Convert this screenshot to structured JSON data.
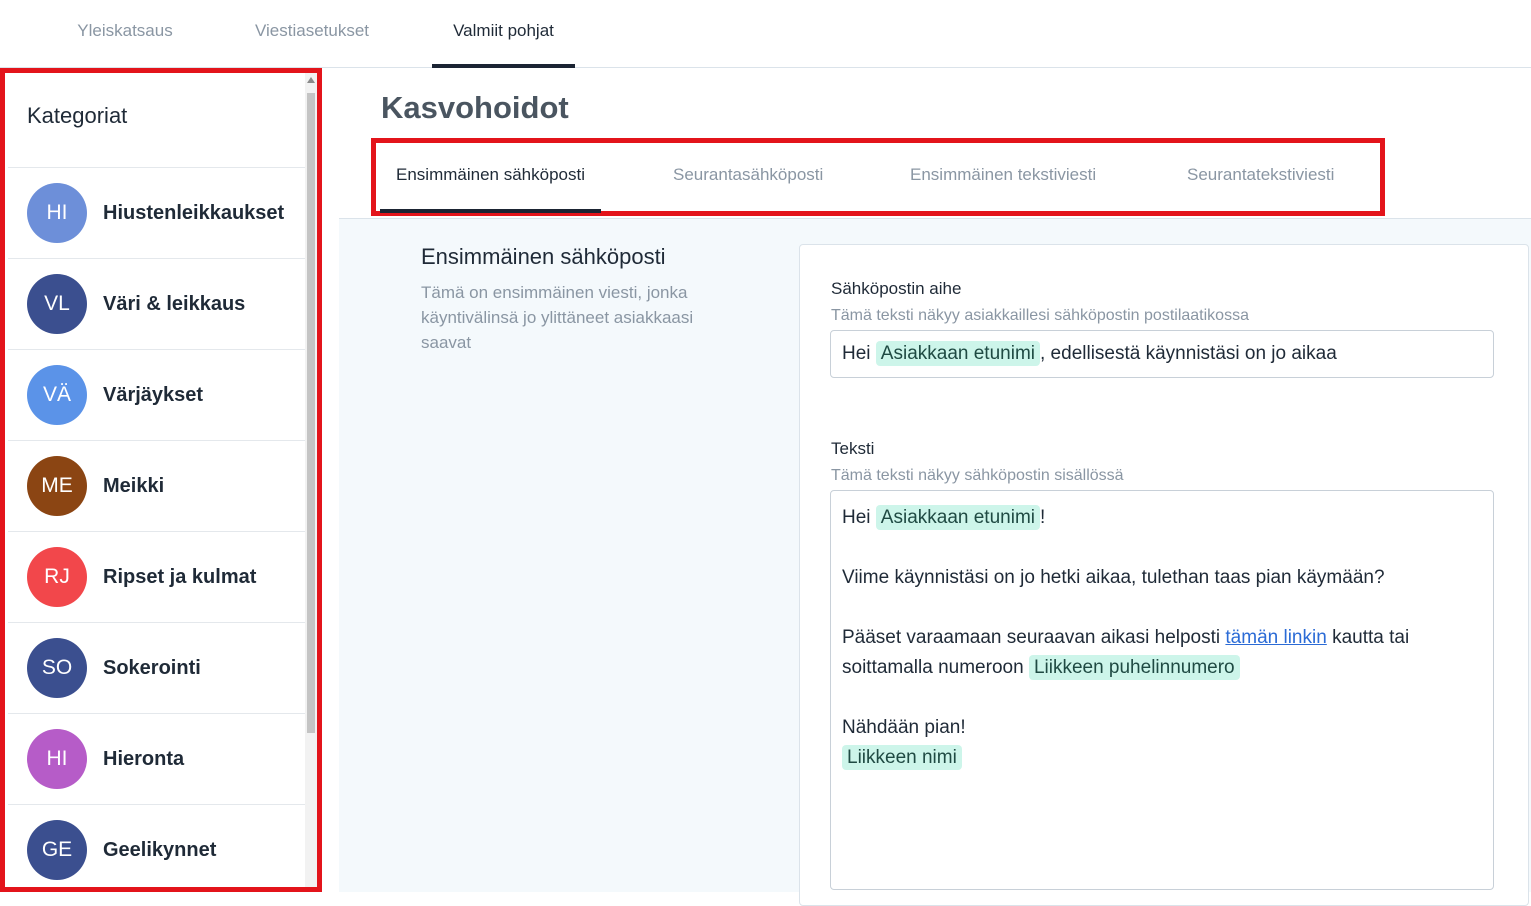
{
  "top_tabs": [
    {
      "label": "Yleiskatsaus"
    },
    {
      "label": "Viestiasetukset"
    },
    {
      "label": "Valmiit pohjat"
    }
  ],
  "sidebar": {
    "title": "Kategoriat",
    "items": [
      {
        "initials": "HI",
        "label": "Hiustenleikkaukset",
        "color": "#6d8fd9"
      },
      {
        "initials": "VL",
        "label": "Väri & leikkaus",
        "color": "#3b4f8f"
      },
      {
        "initials": "VÄ",
        "label": "Värjäykset",
        "color": "#5b93e8"
      },
      {
        "initials": "ME",
        "label": "Meikki",
        "color": "#8b4513"
      },
      {
        "initials": "RJ",
        "label": "Ripset ja kulmat",
        "color": "#f2474b"
      },
      {
        "initials": "SO",
        "label": "Sokerointi",
        "color": "#3b4f8f"
      },
      {
        "initials": "HI",
        "label": "Hieronta",
        "color": "#b65cc8"
      },
      {
        "initials": "GE",
        "label": "Geelikynnet",
        "color": "#3b4f8f"
      }
    ]
  },
  "main": {
    "title": "Kasvohoidot",
    "tabs": [
      {
        "label": "Ensimmäinen sähköposti"
      },
      {
        "label": "Seurantasähköposti"
      },
      {
        "label": "Ensimmäinen tekstiviesti"
      },
      {
        "label": "Seurantatekstiviesti"
      }
    ],
    "section": {
      "title": "Ensimmäinen sähköposti",
      "description": "Tämä on ensimmäinen viesti, jonka käyntivälinsä jo ylittäneet asiakkaasi saavat"
    },
    "subject": {
      "label": "Sähköpostin aihe",
      "help": "Tämä teksti näkyy asiakkaillesi sähköpostin postilaatikossa",
      "prefix": "Hei",
      "tag": "Asiakkaan etunimi",
      "suffix": ", edellisestä käynnistäsi on jo aikaa"
    },
    "body": {
      "label": "Teksti",
      "help": "Tämä teksti näkyy sähköpostin sisällössä",
      "line1_prefix": "Hei",
      "line1_tag": "Asiakkaan etunimi",
      "line1_suffix": "!",
      "line2": "Viime käynnistäsi on jo hetki aikaa, tulethan taas pian käymään?",
      "line3_prefix": "Pääset varaamaan seuraavan aikasi helposti",
      "line3_link": "tämän linkin",
      "line3_suffix": "kautta tai",
      "line4_prefix": "soittamalla numeroon",
      "line4_tag": "Liikkeen puhelinnumero",
      "line5": "Nähdään pian!",
      "line6_tag": "Liikkeen nimi"
    }
  },
  "colors": {
    "highlight": "#e3141b",
    "tag_bg": "#cdf5ea",
    "link": "#2b6bd6"
  }
}
